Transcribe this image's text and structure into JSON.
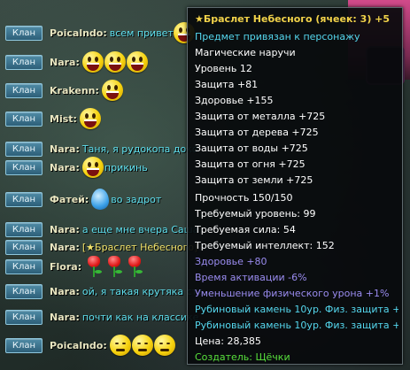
{
  "colors": {
    "clan_button": "#2d5f78",
    "sender": "#e8e5c0",
    "message": "#5fe0ef",
    "item_link": "#f2e36a",
    "tooltip_title": "#f1d24a",
    "tooltip_cyan": "#55d7ee",
    "tooltip_white": "#ffffff",
    "tooltip_lavender": "#9a8cf0",
    "tooltip_green": "#58e03c"
  },
  "chat": {
    "clan_label": "Клан",
    "messages": [
      {
        "sender": "Poicalndo",
        "text": "всем привет",
        "emotes": [
          "smiley"
        ]
      },
      {
        "sender": "Nara",
        "text": "",
        "emotes": [
          "smiley",
          "smiley",
          "smiley"
        ]
      },
      {
        "sender": "Krakenn",
        "text": "",
        "emotes": [
          "smiley"
        ]
      },
      {
        "sender": "Mist",
        "text": "",
        "emotes": [
          "smiley"
        ]
      },
      {
        "sender": "Nara",
        "text": "Таня, я рудокопа доко",
        "emotes": []
      },
      {
        "sender": "Nara",
        "text": "прикинь",
        "emotes": [
          "smiley"
        ]
      },
      {
        "sender": "Фатей",
        "text": "во задрот",
        "emotes": [
          "drop"
        ]
      },
      {
        "sender": "Nara",
        "text": "а еще мне вчера Саша",
        "emotes": []
      },
      {
        "sender": "Nara",
        "text": "[★Браслет Небесного]",
        "emotes": [],
        "item_link": true
      },
      {
        "sender": "Flora",
        "text": "",
        "emotes": [
          "tulip",
          "tulip",
          "tulip"
        ]
      },
      {
        "sender": "Nara",
        "text": "ой, я такая крутяка ста",
        "emotes": []
      },
      {
        "sender": "Nara",
        "text": "почти как на классике",
        "emotes": []
      },
      {
        "sender": "Poicalndo",
        "text": "",
        "emotes": [
          "sleepy",
          "sleepy",
          "sleepy"
        ]
      }
    ]
  },
  "tooltip": {
    "title": "★Браслет Небесного (ячеек: 3) +5",
    "bound": "Предмет привязан к персонажу",
    "type": "Магические наручи",
    "level": "Уровень 12",
    "defense": "Защита +81",
    "health": "Здоровье +155",
    "def_metal": "Защита от металла +725",
    "def_wood": "Защита от дерева +725",
    "def_water": "Защита от воды +725",
    "def_fire": "Защита от огня +725",
    "def_earth": "Защита от земли +725",
    "durability": "Прочность 150/150",
    "req_level": "Требуемый уровень: 99",
    "req_strength": "Требуемая сила: 54",
    "req_int": "Требуемый интеллект: 152",
    "bonus_health": "Здоровье +80",
    "cast_time": "Время активации -6%",
    "phys_reduce": "Уменьшение физического урона +1%",
    "ruby1": "Рубиновый камень 10ур. Физ. защита +85",
    "ruby2": "Рубиновый камень 10ур. Физ. защита +85",
    "price": "Цена: 28,385",
    "creator": "Создатель: Щёчки"
  }
}
